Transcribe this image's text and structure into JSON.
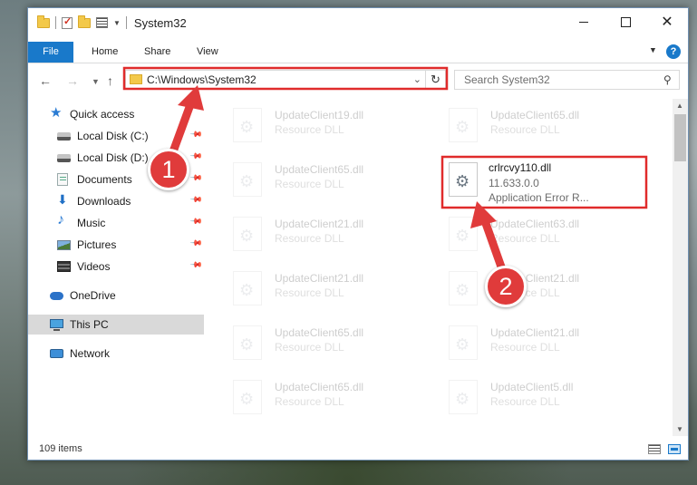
{
  "window": {
    "title": "System32",
    "controls": {
      "minimize": "—",
      "maximize": "☐",
      "close": "✕"
    }
  },
  "ribbon": {
    "tabs": [
      {
        "label": "File"
      },
      {
        "label": "Home"
      },
      {
        "label": "Share"
      },
      {
        "label": "View"
      }
    ],
    "help_label": "?"
  },
  "address": {
    "path": "C:\\Windows\\System32",
    "search_placeholder": "Search System32"
  },
  "nav": {
    "items": [
      {
        "label": "Quick access",
        "icon": "star-icon"
      },
      {
        "label": "Local Disk (C:)",
        "icon": "drive-icon",
        "pinned": true
      },
      {
        "label": "Local Disk (D:)",
        "icon": "drive-icon",
        "pinned": true
      },
      {
        "label": "Documents",
        "icon": "documents-icon",
        "pinned": true
      },
      {
        "label": "Downloads",
        "icon": "downloads-icon",
        "pinned": true
      },
      {
        "label": "Music",
        "icon": "music-icon",
        "pinned": true
      },
      {
        "label": "Pictures",
        "icon": "pictures-icon",
        "pinned": true
      },
      {
        "label": "Videos",
        "icon": "videos-icon",
        "pinned": true
      },
      {
        "label": "OneDrive",
        "icon": "onedrive-icon"
      },
      {
        "label": "This PC",
        "icon": "pc-icon",
        "selected": true
      },
      {
        "label": "Network",
        "icon": "network-icon"
      }
    ]
  },
  "files": {
    "highlighted": {
      "name": "crlrcvy110.dll",
      "version": "11.633.0.0",
      "description": "Application Error R..."
    },
    "left_column": [
      {
        "name": "UpdateClient19.dll",
        "type": "Resource DLL"
      },
      {
        "name": "UpdateClient65.dll",
        "type": "Resource DLL"
      },
      {
        "name": "UpdateClient21.dll",
        "type": "Resource DLL"
      },
      {
        "name": "UpdateClient21.dll",
        "type": "Resource DLL"
      },
      {
        "name": "UpdateClient65.dll",
        "type": "Resource DLL"
      },
      {
        "name": "UpdateClient65.dll",
        "type": "Resource DLL"
      }
    ],
    "right_column": [
      {
        "name": "UpdateClient65.dll",
        "type": "Resource DLL"
      },
      {
        "name": "UpdateClient63.dll",
        "type": "Resource DLL"
      },
      {
        "name": "UpdateClient21.dll",
        "type": "Resource DLL"
      },
      {
        "name": "UpdateClient21.dll",
        "type": "Resource DLL"
      },
      {
        "name": "UpdateClient5.dll",
        "type": "Resource DLL"
      }
    ]
  },
  "status": {
    "item_count": "109 items"
  },
  "annotations": {
    "callout1": "1",
    "callout2": "2",
    "accent_color": "#e02b2b"
  }
}
